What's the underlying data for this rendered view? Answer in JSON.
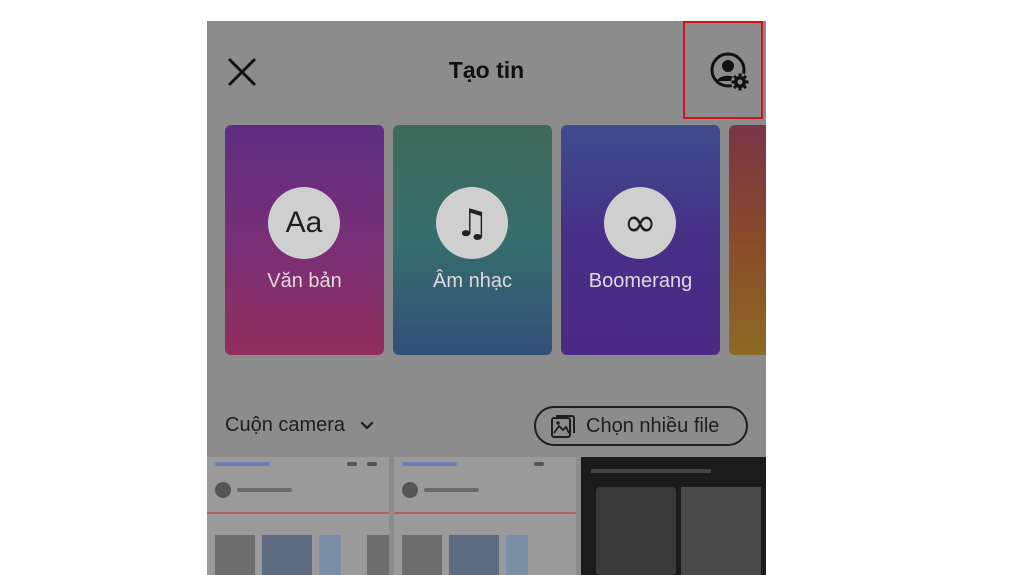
{
  "header": {
    "title": "Tạo tin",
    "close_icon": "close-icon",
    "settings_icon": "person-gear-icon"
  },
  "cards": [
    {
      "label": "Văn bản",
      "icon_text": "Aa",
      "icon": "text-aa-icon"
    },
    {
      "label": "Âm nhạc",
      "icon_text": "♫",
      "icon": "music-note-icon"
    },
    {
      "label": "Boomerang",
      "icon_text": "∞",
      "icon": "infinity-icon"
    }
  ],
  "gallery": {
    "source_label": "Cuộn camera",
    "multi_select_label": "Chọn nhiều file"
  },
  "colors": {
    "highlight_border": "#d3121b",
    "overlay": "#8c8c8c"
  }
}
